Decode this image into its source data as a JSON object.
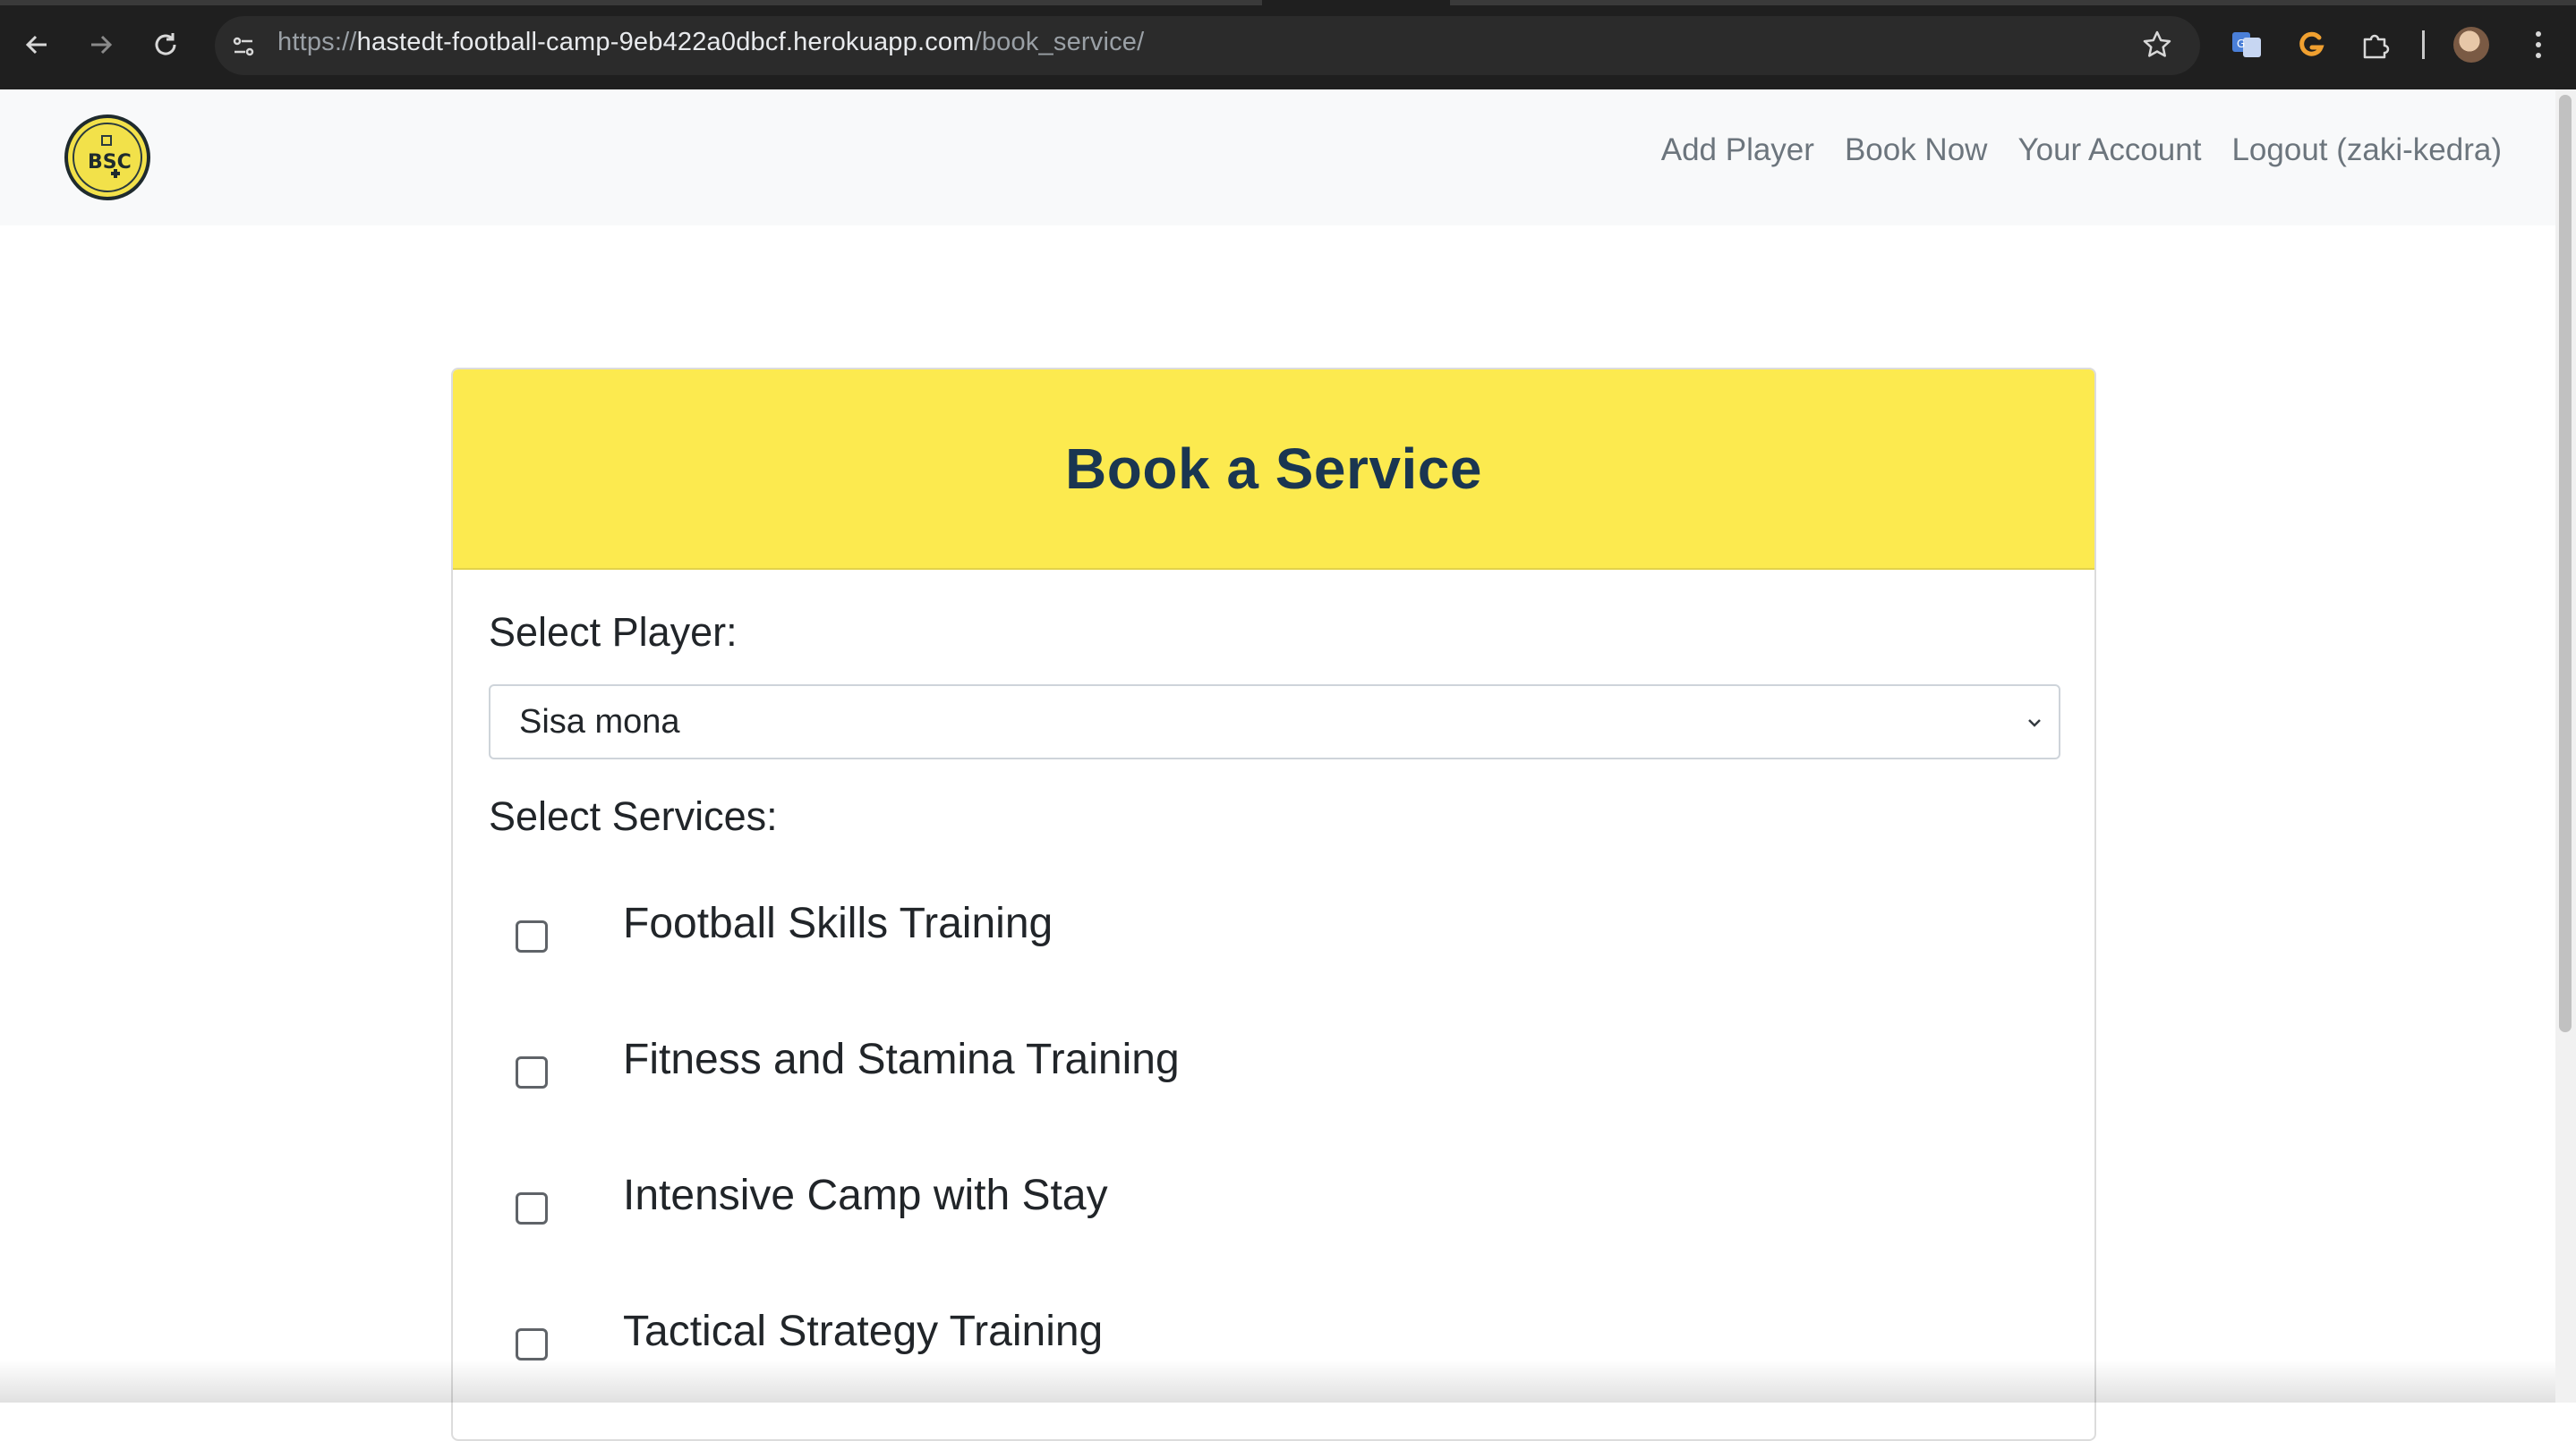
{
  "browser": {
    "url_scheme": "https://",
    "url_host": "hastedt-football-camp-9eb422a0dbcf.herokuapp.com",
    "url_path": "/book_service/",
    "chrome_color": "#1f1f1f",
    "icons": [
      "back-icon",
      "forward-icon",
      "reload-icon",
      "site-info-icon",
      "bookmark-star-icon",
      "translate-extension-icon",
      "grammarly-extension-icon",
      "extensions-puzzle-icon",
      "profile-avatar",
      "more-menu-icon"
    ]
  },
  "navbar": {
    "logo_text": "BSC",
    "links": [
      "Add Player",
      "Book Now",
      "Your Account",
      "Logout (zaki-kedra)"
    ]
  },
  "form": {
    "title": "Book a Service",
    "select_player_label": "Select Player:",
    "selected_player": "Sisa mona",
    "select_services_label": "Select Services:",
    "services": [
      {
        "label": "Football Skills Training",
        "checked": false
      },
      {
        "label": "Fitness and Stamina Training",
        "checked": false
      },
      {
        "label": "Intensive Camp with Stay",
        "checked": false
      },
      {
        "label": "Tactical Strategy Training",
        "checked": false
      }
    ]
  },
  "colors": {
    "header_yellow": "#fcea4f",
    "title_navy": "#1a3651",
    "nav_link_gray": "#6c757d",
    "navbar_bg": "#f8f9fa"
  }
}
